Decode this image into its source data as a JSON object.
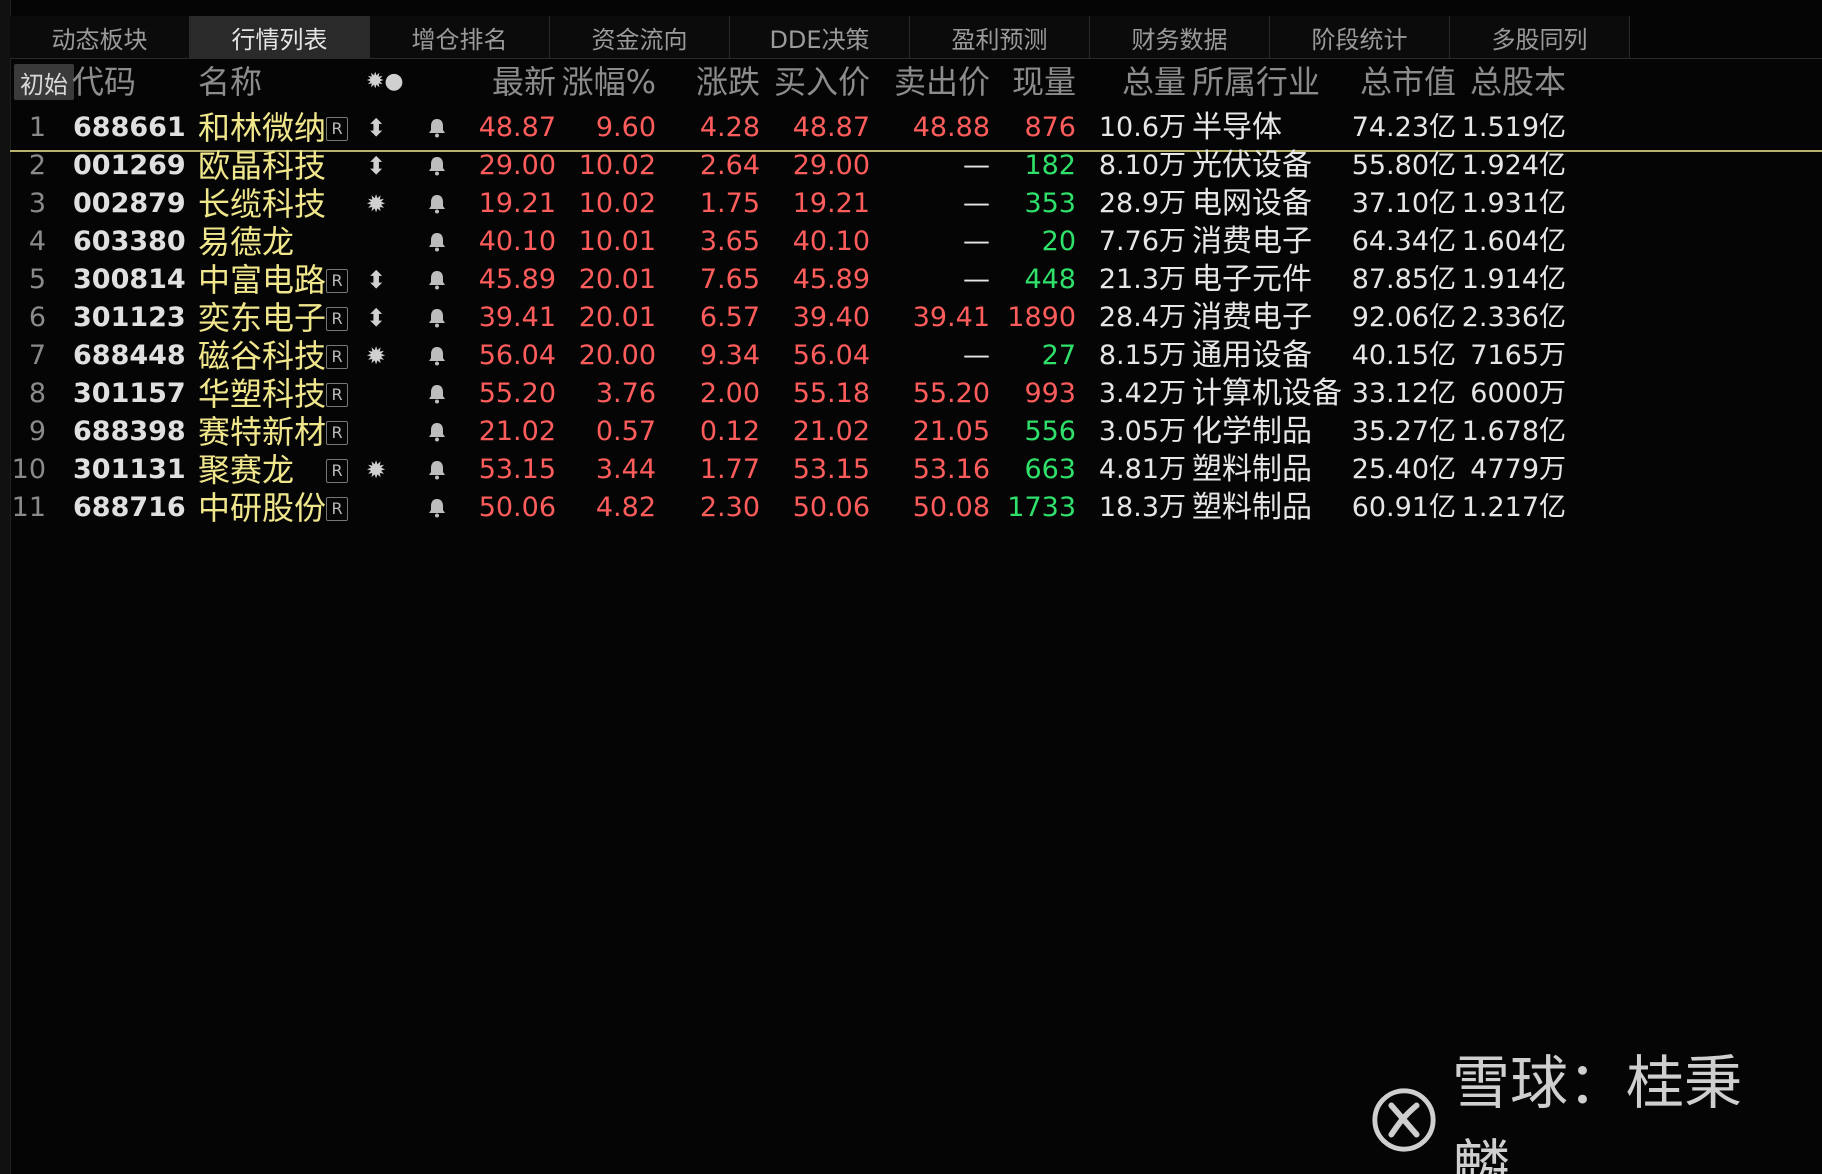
{
  "tabs": [
    {
      "label": "动态板块",
      "active": false
    },
    {
      "label": "行情列表",
      "active": true
    },
    {
      "label": "增仓排名",
      "active": false
    },
    {
      "label": "资金流向",
      "active": false
    },
    {
      "label": "DDE决策",
      "active": false
    },
    {
      "label": "盈利预测",
      "active": false
    },
    {
      "label": "财务数据",
      "active": false
    },
    {
      "label": "阶段统计",
      "active": false
    },
    {
      "label": "多股同列",
      "active": false
    }
  ],
  "header": {
    "init_button": "初始",
    "code": "代码",
    "name": "名称",
    "flags": "✹●",
    "latest": "最新",
    "change_pct": "涨幅%",
    "change": "涨跌",
    "bid": "买入价",
    "ask": "卖出价",
    "current_volume": "现量",
    "total_volume": "总量",
    "industry": "所属行业",
    "market_cap": "总市值",
    "total_shares": "总股本"
  },
  "rows": [
    {
      "idx": "1",
      "code": "688661",
      "name": "和林微纳",
      "r": true,
      "flag": "⬍",
      "latest": "48.87",
      "change_pct": "9.60",
      "change": "4.28",
      "bid": "48.87",
      "ask": "48.88",
      "cur_vol": "876",
      "cur_vol_color": "red",
      "total_vol": "10.6万",
      "industry": "半导体",
      "market_cap": "74.23亿",
      "shares": "1.519亿",
      "selected": true
    },
    {
      "idx": "2",
      "code": "001269",
      "name": "欧晶科技",
      "r": false,
      "flag": "⬍",
      "latest": "29.00",
      "change_pct": "10.02",
      "change": "2.64",
      "bid": "29.00",
      "ask": "—",
      "cur_vol": "182",
      "cur_vol_color": "green",
      "total_vol": "8.10万",
      "industry": "光伏设备",
      "market_cap": "55.80亿",
      "shares": "1.924亿"
    },
    {
      "idx": "3",
      "code": "002879",
      "name": "长缆科技",
      "r": false,
      "flag": "✹",
      "latest": "19.21",
      "change_pct": "10.02",
      "change": "1.75",
      "bid": "19.21",
      "ask": "—",
      "cur_vol": "353",
      "cur_vol_color": "green",
      "total_vol": "28.9万",
      "industry": "电网设备",
      "market_cap": "37.10亿",
      "shares": "1.931亿"
    },
    {
      "idx": "4",
      "code": "603380",
      "name": "易德龙",
      "r": false,
      "flag": "",
      "latest": "40.10",
      "change_pct": "10.01",
      "change": "3.65",
      "bid": "40.10",
      "ask": "—",
      "cur_vol": "20",
      "cur_vol_color": "green",
      "total_vol": "7.76万",
      "industry": "消费电子",
      "market_cap": "64.34亿",
      "shares": "1.604亿"
    },
    {
      "idx": "5",
      "code": "300814",
      "name": "中富电路",
      "r": true,
      "flag": "⬍",
      "latest": "45.89",
      "change_pct": "20.01",
      "change": "7.65",
      "bid": "45.89",
      "ask": "—",
      "cur_vol": "448",
      "cur_vol_color": "green",
      "total_vol": "21.3万",
      "industry": "电子元件",
      "market_cap": "87.85亿",
      "shares": "1.914亿"
    },
    {
      "idx": "6",
      "code": "301123",
      "name": "奕东电子",
      "r": true,
      "flag": "⬍",
      "latest": "39.41",
      "change_pct": "20.01",
      "change": "6.57",
      "bid": "39.40",
      "ask": "39.41",
      "cur_vol": "1890",
      "cur_vol_color": "red",
      "total_vol": "28.4万",
      "industry": "消费电子",
      "market_cap": "92.06亿",
      "shares": "2.336亿"
    },
    {
      "idx": "7",
      "code": "688448",
      "name": "磁谷科技",
      "r": true,
      "flag": "✹",
      "latest": "56.04",
      "change_pct": "20.00",
      "change": "9.34",
      "bid": "56.04",
      "ask": "—",
      "cur_vol": "27",
      "cur_vol_color": "green",
      "total_vol": "8.15万",
      "industry": "通用设备",
      "market_cap": "40.15亿",
      "shares": "7165万"
    },
    {
      "idx": "8",
      "code": "301157",
      "name": "华塑科技",
      "r": true,
      "flag": "",
      "latest": "55.20",
      "change_pct": "3.76",
      "change": "2.00",
      "bid": "55.18",
      "ask": "55.20",
      "cur_vol": "993",
      "cur_vol_color": "red",
      "total_vol": "3.42万",
      "industry": "计算机设备",
      "market_cap": "33.12亿",
      "shares": "6000万"
    },
    {
      "idx": "9",
      "code": "688398",
      "name": "赛特新材",
      "r": true,
      "flag": "",
      "latest": "21.02",
      "change_pct": "0.57",
      "change": "0.12",
      "bid": "21.02",
      "ask": "21.05",
      "cur_vol": "556",
      "cur_vol_color": "green",
      "total_vol": "3.05万",
      "industry": "化学制品",
      "market_cap": "35.27亿",
      "shares": "1.678亿"
    },
    {
      "idx": "10",
      "code": "301131",
      "name": "聚赛龙",
      "r": true,
      "flag": "✹",
      "latest": "53.15",
      "change_pct": "3.44",
      "change": "1.77",
      "bid": "53.15",
      "ask": "53.16",
      "cur_vol": "663",
      "cur_vol_color": "green",
      "total_vol": "4.81万",
      "industry": "塑料制品",
      "market_cap": "25.40亿",
      "shares": "4779万"
    },
    {
      "idx": "11",
      "code": "688716",
      "name": "中研股份",
      "r": true,
      "flag": "",
      "latest": "50.06",
      "change_pct": "4.82",
      "change": "2.30",
      "bid": "50.06",
      "ask": "50.08",
      "cur_vol": "1733",
      "cur_vol_color": "green",
      "total_vol": "18.3万",
      "industry": "塑料制品",
      "market_cap": "60.91亿",
      "shares": "1.217亿"
    }
  ],
  "watermark": {
    "text": "雪球：桂秉麟",
    "logo": "xueqiu-logo-icon"
  },
  "colors": {
    "up": "#ff5c5c",
    "down": "#2fe06a",
    "name": "#f0e68c",
    "background": "#050505"
  }
}
